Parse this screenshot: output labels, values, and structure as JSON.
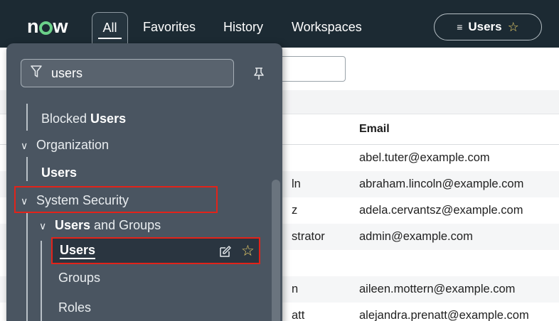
{
  "topbar": {
    "logo": "now",
    "tabs": [
      "All",
      "Favorites",
      "History",
      "Workspaces"
    ],
    "context_pill": {
      "icon": "list-icon",
      "label": "Users",
      "star": "☆"
    }
  },
  "menu": {
    "filter": {
      "value": "users",
      "icon": "filter-icon"
    },
    "items": [
      {
        "prefix": "Blocked ",
        "bold": "Users"
      },
      {
        "label": "Organization"
      },
      {
        "bold": "Users"
      },
      {
        "label": "System Security"
      },
      {
        "bold": "Users",
        "suffix": " and Groups"
      },
      {
        "bold": "Users"
      },
      {
        "label": "Groups"
      },
      {
        "label": "Roles"
      }
    ]
  },
  "table": {
    "email_header": "Email",
    "rows": [
      {
        "name": "",
        "email": "abel.tuter@example.com"
      },
      {
        "name": "ln",
        "email": "abraham.lincoln@example.com"
      },
      {
        "name": "z",
        "email": "adela.cervantsz@example.com"
      },
      {
        "name": "strator",
        "email": "admin@example.com"
      },
      {
        "name": "",
        "email": ""
      },
      {
        "name": "n",
        "email": "aileen.mottern@example.com"
      },
      {
        "name": "att",
        "email": "alejandra.prenatt@example.com"
      }
    ]
  },
  "colors": {
    "topbar": "#1c2a33",
    "menu": "#4a5561",
    "highlight": "#e2231a",
    "accent_star": "#f0d36a"
  }
}
